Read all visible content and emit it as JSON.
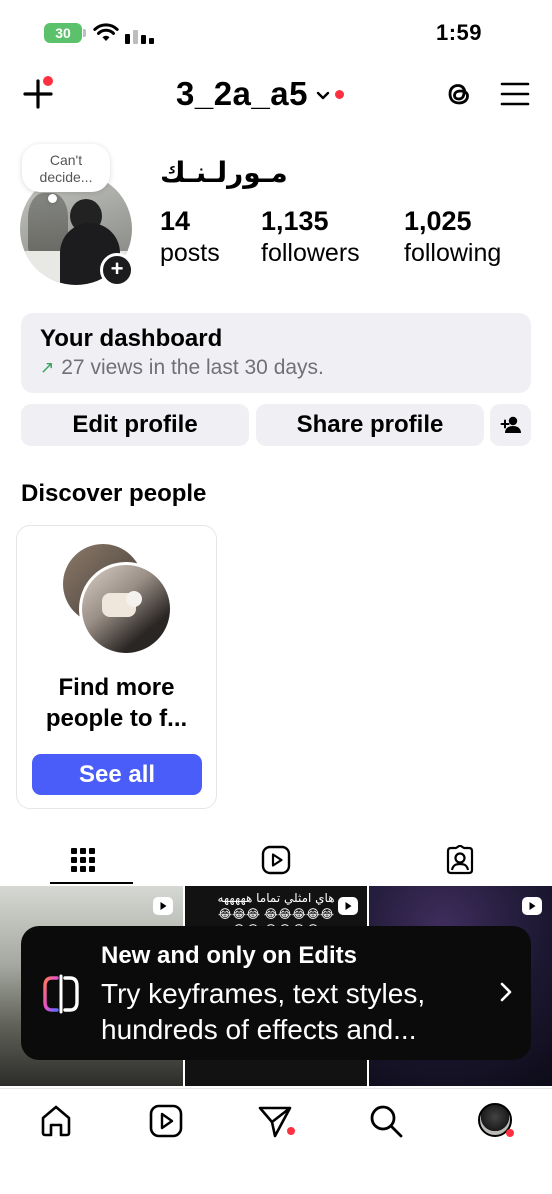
{
  "status_bar": {
    "battery": "30",
    "time": "1:59"
  },
  "header": {
    "username": "3_2a_a5"
  },
  "profile": {
    "note": "Can't decide...",
    "display_name": "مـورلـنـك",
    "stats": [
      {
        "value": "14",
        "label": "posts"
      },
      {
        "value": "1,135",
        "label": "followers"
      },
      {
        "value": "1,025",
        "label": "following"
      }
    ]
  },
  "dashboard": {
    "title": "Your dashboard",
    "arrow": "↗",
    "subtitle": "27 views in the last 30 days."
  },
  "actions": {
    "edit": "Edit profile",
    "share": "Share profile"
  },
  "discover": {
    "title": "Discover people",
    "card_text": "Find more people to f...",
    "button": "See all"
  },
  "grid": {
    "cell2_text": "هاي امثلي تماما هههههه 😂😂😂 😂😂😂😂😂😂😂 😂😂😂😂"
  },
  "promo": {
    "title": "New and only on Edits",
    "body": "Try keyframes, text styles, hundreds of effects and..."
  },
  "icons": {
    "header": [
      "plus-icon",
      "chevron-down-icon",
      "threads-icon",
      "menu-icon"
    ],
    "tabs": [
      "grid-icon",
      "reels-icon",
      "tagged-icon"
    ],
    "nav": [
      "home-icon",
      "reels-icon",
      "send-icon",
      "search-icon",
      "profile-avatar"
    ]
  },
  "colors": {
    "accent_blue": "#4a5df9",
    "notification_red": "#ff3040",
    "battery_green": "#5bc26b"
  }
}
